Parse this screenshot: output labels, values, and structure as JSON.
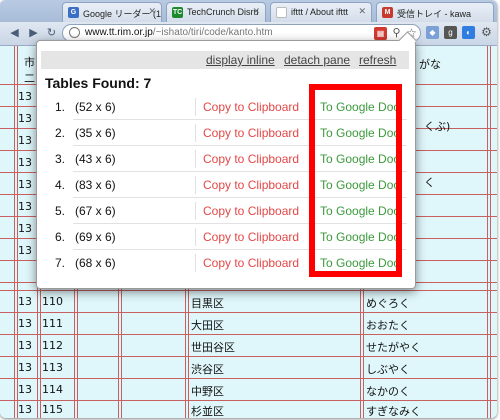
{
  "browser": {
    "tabs": [
      {
        "title": "Google リーダー (1",
        "icon": "google-reader-icon",
        "favicon_letter": "G",
        "color": "#3b6fc7"
      },
      {
        "title": "TechCrunch Disru",
        "icon": "techcrunch-icon",
        "favicon_letter": "TC",
        "color": "#1d8a2e"
      },
      {
        "title": "ifttt / About ifttt",
        "icon": "ifttt-icon",
        "favicon_letter": "",
        "color": "#ffffff"
      },
      {
        "title": "受信トレイ - kawa",
        "icon": "gmail-icon",
        "favicon_letter": "M",
        "color": "#c83a2e"
      }
    ],
    "url_host": "www.tt.rim.or.jp",
    "url_path": "/~ishato/tiri/code/kanto.htm"
  },
  "page": {
    "header_left": "市",
    "header_left2": "二",
    "header_right": "がな",
    "rows_upper": [
      {
        "pref": "13",
        "right": ""
      },
      {
        "pref": "13",
        "right": "くぶ)"
      },
      {
        "pref": "13",
        "right": ""
      },
      {
        "pref": "13",
        "right": ""
      },
      {
        "pref": "13",
        "right": "く"
      },
      {
        "pref": "13",
        "right": ""
      },
      {
        "pref": "13",
        "right": ""
      },
      {
        "pref": "13",
        "right": ""
      }
    ],
    "rows_lower": [
      {
        "pref": "13",
        "code": "110",
        "name": "目黒区",
        "kana": "めぐろく"
      },
      {
        "pref": "13",
        "code": "111",
        "name": "大田区",
        "kana": "おおたく"
      },
      {
        "pref": "13",
        "code": "112",
        "name": "世田谷区",
        "kana": "せたがやく"
      },
      {
        "pref": "13",
        "code": "113",
        "name": "渋谷区",
        "kana": "しぶやく"
      },
      {
        "pref": "13",
        "code": "114",
        "name": "中野区",
        "kana": "なかのく"
      },
      {
        "pref": "13",
        "code": "115",
        "name": "杉並区",
        "kana": "すぎなみく"
      }
    ]
  },
  "popup": {
    "links": {
      "inline": "display inline",
      "detach": "detach pane",
      "refresh": "refresh"
    },
    "found_label": "Tables Found: 7",
    "tables": [
      {
        "num": "1.",
        "dim": "(52 x 6)",
        "copy": "Copy to Clipboard",
        "gdoc": "To Google Doc"
      },
      {
        "num": "2.",
        "dim": "(35 x 6)",
        "copy": "Copy to Clipboard",
        "gdoc": "To Google Doc"
      },
      {
        "num": "3.",
        "dim": "(43 x 6)",
        "copy": "Copy to Clipboard",
        "gdoc": "To Google Doc"
      },
      {
        "num": "4.",
        "dim": "(83 x 6)",
        "copy": "Copy to Clipboard",
        "gdoc": "To Google Doc"
      },
      {
        "num": "5.",
        "dim": "(67 x 6)",
        "copy": "Copy to Clipboard",
        "gdoc": "To Google Doc"
      },
      {
        "num": "6.",
        "dim": "(69 x 6)",
        "copy": "Copy to Clipboard",
        "gdoc": "To Google Doc"
      },
      {
        "num": "7.",
        "dim": "(68 x 6)",
        "copy": "Copy to Clipboard",
        "gdoc": "To Google Doc"
      }
    ]
  },
  "colors": {
    "copy": "#e34848",
    "gdoc": "#3c9a3c",
    "highlight": "#ff0000",
    "table_border": "#c86060",
    "page_bg": "#dff6fa"
  }
}
